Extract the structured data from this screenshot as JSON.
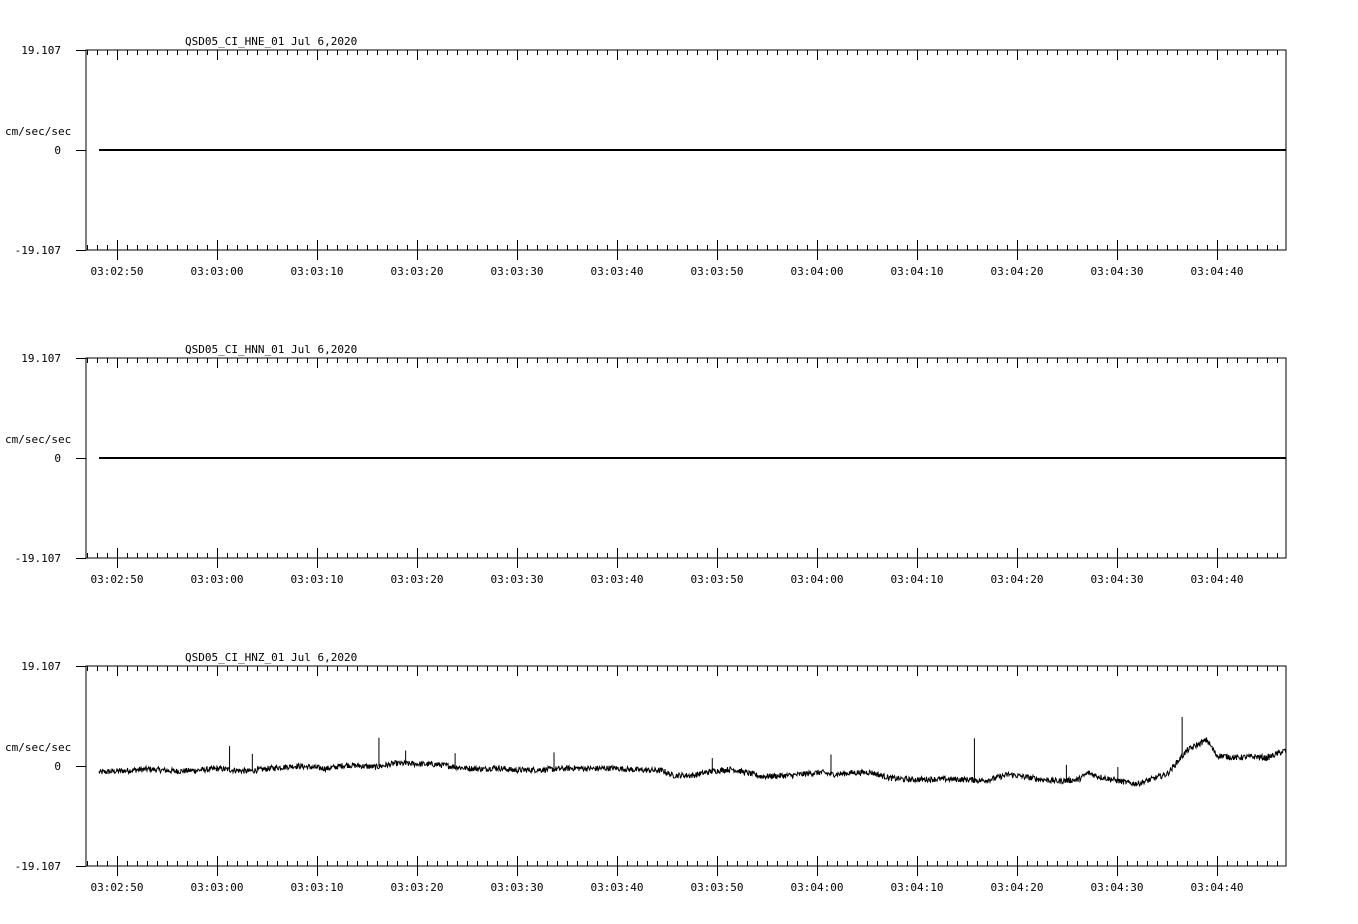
{
  "chart_data": [
    {
      "type": "line",
      "title": "QSD05_CI_HNE_01  Jul 6,2020",
      "ylabel": "cm/sec/sec",
      "ytick_labels": [
        "19.107",
        "0",
        "-19.107"
      ],
      "ylim": [
        -19.107,
        19.107
      ],
      "xtick_labels": [
        "03:02:50",
        "03:03:00",
        "03:03:10",
        "03:03:20",
        "03:03:30",
        "03:03:40",
        "03:03:50",
        "03:04:00",
        "03:04:10",
        "03:04:20",
        "03:04:30",
        "03:04:40"
      ],
      "x_start_seconds_before_first_label": 2.7,
      "x_span_seconds": 120,
      "series": [
        {
          "x": [
            0,
            120
          ],
          "y": [
            0,
            0
          ]
        }
      ]
    },
    {
      "type": "line",
      "title": "QSD05_CI_HNN_01  Jul 6,2020",
      "ylabel": "cm/sec/sec",
      "ytick_labels": [
        "19.107",
        "0",
        "-19.107"
      ],
      "ylim": [
        -19.107,
        19.107
      ],
      "xtick_labels": [
        "03:02:50",
        "03:03:00",
        "03:03:10",
        "03:03:20",
        "03:03:30",
        "03:03:40",
        "03:03:50",
        "03:04:00",
        "03:04:10",
        "03:04:20",
        "03:04:30",
        "03:04:40"
      ],
      "series": [
        {
          "x": [
            0,
            120
          ],
          "y": [
            0,
            0
          ]
        }
      ]
    },
    {
      "type": "line",
      "title": "QSD05_CI_HNZ_01  Jul 6,2020",
      "ylabel": "cm/sec/sec",
      "ytick_labels": [
        "19.107",
        "0",
        "-19.107"
      ],
      "ylim": [
        -19.107,
        19.107
      ],
      "xtick_labels": [
        "03:02:50",
        "03:03:00",
        "03:03:10",
        "03:03:20",
        "03:03:30",
        "03:03:40",
        "03:03:50",
        "03:04:00",
        "03:04:10",
        "03:04:20",
        "03:04:30",
        "03:04:40"
      ],
      "series": [
        {
          "x": [
            0,
            5,
            8,
            10,
            12,
            15,
            18,
            20,
            23,
            25,
            28,
            30,
            32,
            34,
            35,
            37,
            39,
            40,
            42,
            45,
            48,
            50,
            52,
            54,
            57,
            58,
            60,
            62,
            64,
            67,
            70,
            72,
            73,
            74,
            75,
            76,
            78,
            80,
            82,
            85,
            88,
            89,
            90,
            92,
            95,
            97,
            99,
            100,
            101,
            103,
            104,
            105,
            106,
            108,
            110,
            112,
            113,
            115,
            117,
            118,
            120
          ],
          "y": [
            -1.2,
            -0.6,
            -1.0,
            -0.8,
            -0.5,
            -1.0,
            -0.3,
            0.0,
            -0.5,
            0.2,
            -0.2,
            0.5,
            0.4,
            0.3,
            0.1,
            -0.4,
            -0.6,
            -0.3,
            -0.8,
            -0.7,
            -0.4,
            -0.5,
            -0.4,
            -0.7,
            -0.9,
            -1.8,
            -1.8,
            -1.0,
            -0.6,
            -2.0,
            -1.8,
            -1.4,
            -1.2,
            -1.6,
            -1.5,
            -1.3,
            -1.2,
            -2.3,
            -2.6,
            -2.5,
            -2.6,
            -2.8,
            -2.6,
            -1.6,
            -2.5,
            -2.9,
            -2.6,
            -1.3,
            -2.0,
            -2.8,
            -3.2,
            -3.4,
            -2.8,
            -1.5,
            3.0,
            5.0,
            2.0,
            1.6,
            1.8,
            1.5,
            3.0
          ]
        }
      ]
    }
  ]
}
